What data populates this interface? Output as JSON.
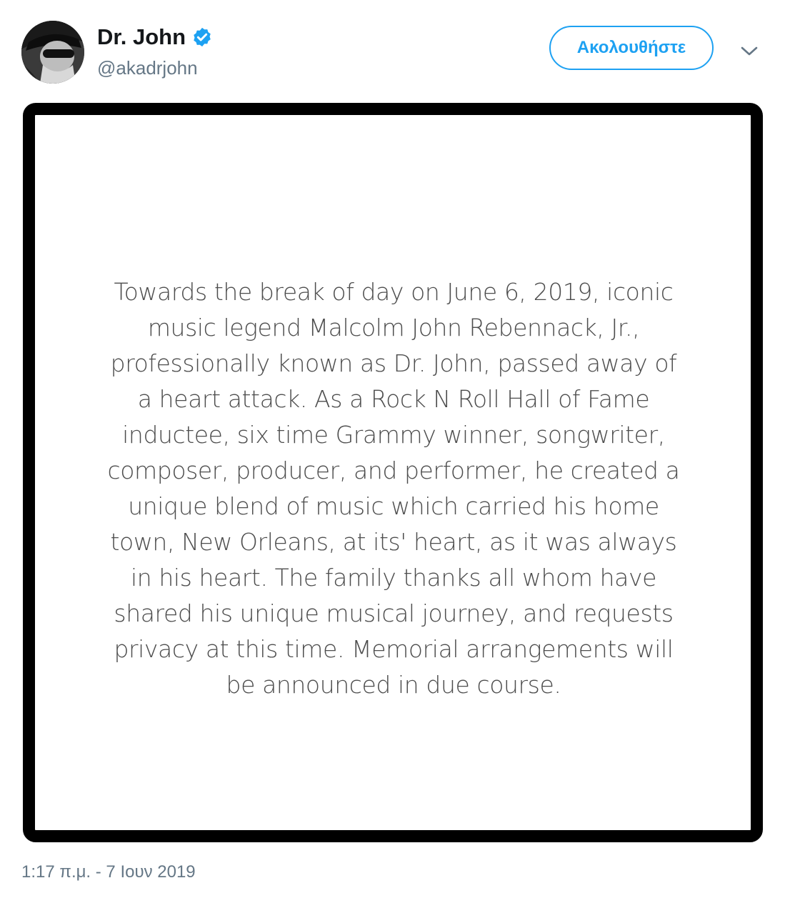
{
  "header": {
    "display_name": "Dr. John",
    "handle": "@akadrjohn",
    "follow_label": "Ακολουθήστε",
    "verified_icon": "verified-badge-icon",
    "caret_icon": "chevron-down-icon"
  },
  "media": {
    "lines": [
      "Towards the break of day on June 6, 2019, iconic",
      "music legend Malcolm John Rebennack, Jr.,",
      "professionally known as Dr. John, passed away of",
      "a heart attack. As a Rock N Roll Hall of Fame",
      "inductee, six time Grammy winner, songwriter,",
      "composer, producer, and performer, he created a",
      "unique blend of music which carried his home",
      "town, New Orleans, at its' heart, as it was always",
      "in his heart. The family thanks all whom have",
      "shared his unique musical journey, and requests",
      "privacy at this time. Memorial arrangements will",
      "be announced in due course."
    ]
  },
  "footer": {
    "timestamp": "1:17 π.μ. - 7 Ιουν 2019"
  },
  "colors": {
    "accent": "#1da1f2",
    "name": "#14171a",
    "secondary": "#657786",
    "statement_text": "#4d4d4d",
    "frame": "#000000"
  }
}
